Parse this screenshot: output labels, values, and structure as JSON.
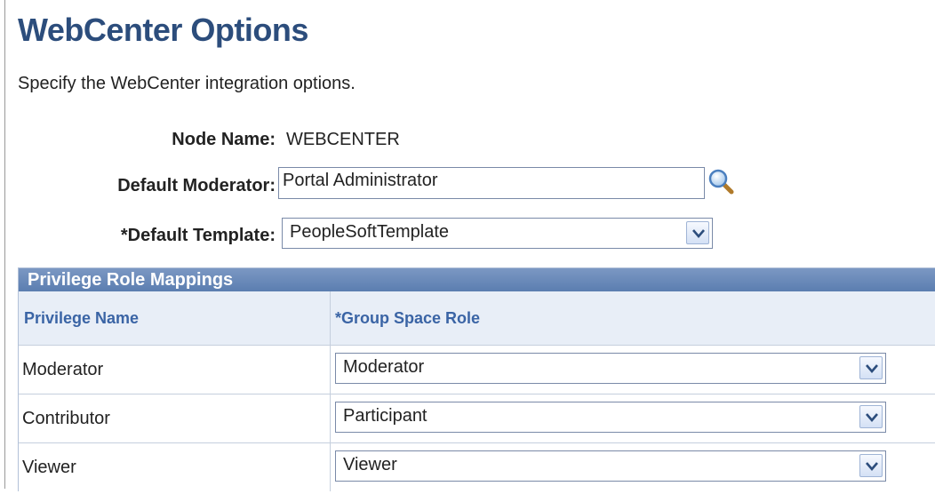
{
  "page": {
    "title": "WebCenter Options",
    "description": "Specify the WebCenter integration options."
  },
  "form": {
    "node_name_label": "Node Name:",
    "node_name_value": "WEBCENTER",
    "moderator_label": "Default Moderator:",
    "moderator_value": "Portal Administrator",
    "template_label": "*Default Template:",
    "template_value": "PeopleSoftTemplate"
  },
  "grid": {
    "title": "Privilege Role Mappings",
    "columns": [
      "Privilege Name",
      "*Group Space Role"
    ],
    "rows": [
      {
        "privilege": "Moderator",
        "role": "Moderator"
      },
      {
        "privilege": "Contributor",
        "role": "Participant"
      },
      {
        "privilege": "Viewer",
        "role": "Viewer"
      }
    ]
  },
  "icons": {
    "lookup": "magnifier-icon",
    "dropdown": "chevron-down-icon"
  },
  "colors": {
    "title": "#2c4d7c",
    "grid_header": "#5b7eb0",
    "column_header_text": "#3a64a5"
  }
}
